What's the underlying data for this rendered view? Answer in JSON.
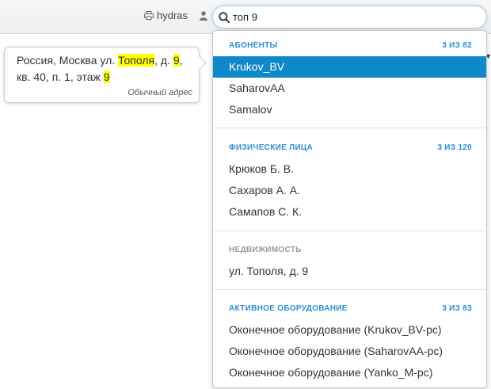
{
  "header": {
    "host_label": "hydras",
    "search_value": "топ 9"
  },
  "popover": {
    "parts": [
      "Россия, Москва ул. ",
      "Тополя",
      ", д. ",
      "9",
      ",",
      "кв. 40, п. 1, этаж ",
      "9"
    ],
    "type_label": "Обычный адрес"
  },
  "sections": [
    {
      "title": "АБОНЕНТЫ",
      "count": "3 ИЗ 82",
      "items": [
        "Krukov_BV",
        "SaharovAA",
        "Samalov"
      ]
    },
    {
      "title": "ФИЗИЧЕСКИЕ ЛИЦА",
      "count": "3 ИЗ 120",
      "items": [
        "Крюков Б. В.",
        "Сахаров А. А.",
        "Самапов С. К."
      ]
    },
    {
      "title": "НЕДВИЖИМОСТЬ",
      "items": [
        "ул. Тополя, д. 9"
      ]
    },
    {
      "title": "АКТИВНОЕ ОБОРУДОВАНИЕ",
      "count": "3 ИЗ 83",
      "items": [
        "Оконечное оборудование (Krukov_BV-pc)",
        "Оконечное оборудование (SaharovAA-pc)",
        "Оконечное оборудование (Yanko_M-pc)"
      ]
    }
  ],
  "colors": {
    "accent": "#2a8fd1",
    "active_item_bg": "#0f89c9",
    "highlight": "#ffff00",
    "muted_heading": "#9a9a9a"
  },
  "icons": {
    "host": "printer-icon",
    "user": "user-icon",
    "search": "search-icon"
  }
}
